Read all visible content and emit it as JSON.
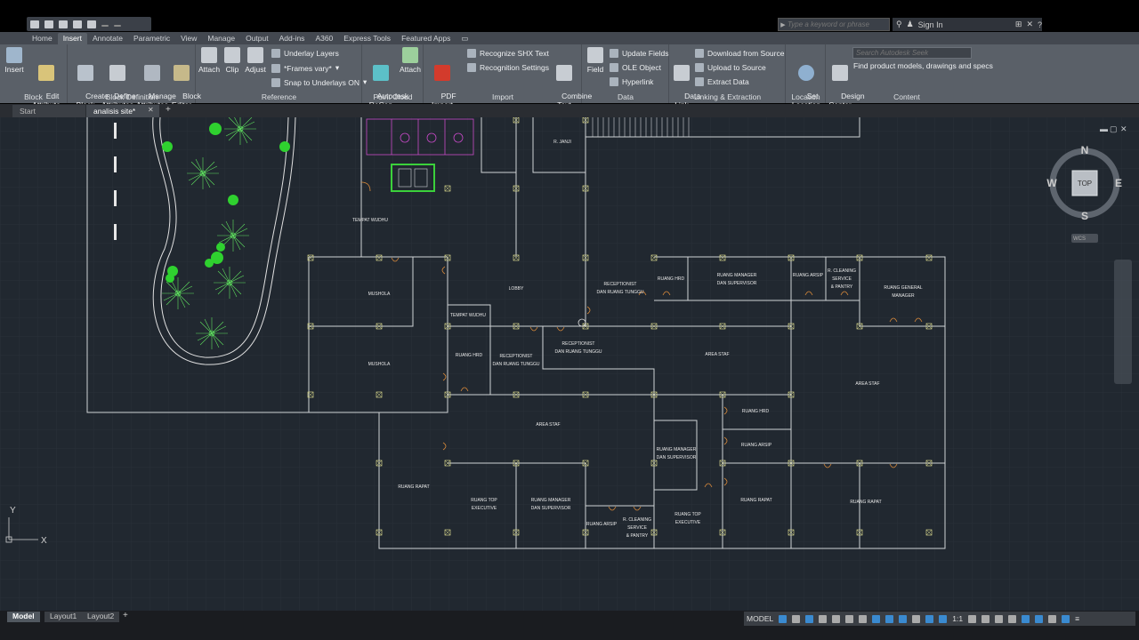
{
  "app": {
    "search_placeholder": "Type a keyword or phrase",
    "sign_in": "Sign In"
  },
  "ribbon_tabs": [
    "Home",
    "Insert",
    "Annotate",
    "Parametric",
    "View",
    "Manage",
    "Output",
    "Add-ins",
    "A360",
    "Express Tools",
    "Featured Apps"
  ],
  "ribbon": {
    "block_panel": {
      "title": "Block",
      "insert": "Insert",
      "edit_attribute": "Edit\nAttribute"
    },
    "block_def_panel": {
      "title": "Block Definition",
      "create_block": "Create\nBlock",
      "define_attributes": "Define\nAttributes",
      "manage_attributes": "Manage\nAttributes",
      "block_editor": "Block\nEditor"
    },
    "reference_panel": {
      "title": "Reference",
      "attach": "Attach",
      "clip": "Clip",
      "adjust": "Adjust",
      "underlay_layers": "Underlay Layers",
      "frames_vary": "*Frames vary*",
      "snap_underlays": "Snap to Underlays ON"
    },
    "point_cloud_panel": {
      "title": "Point Cloud",
      "recap": "Autodesk\nReCap",
      "attach": "Attach"
    },
    "import_panel": {
      "title": "Import",
      "pdf_import": "PDF\nImport",
      "recognize_shx": "Recognize SHX Text",
      "recognition_settings": "Recognition Settings",
      "combine_text": "Combine\nText"
    },
    "data_panel": {
      "title": "Data",
      "field": "Field",
      "update_fields": "Update Fields",
      "ole_object": "OLE Object",
      "hyperlink": "Hyperlink"
    },
    "linking_panel": {
      "title": "Linking & Extraction",
      "data_link": "Data\nLink",
      "download_source": "Download from Source",
      "upload_source": "Upload to Source",
      "extract_data": "Extract  Data"
    },
    "location_panel": {
      "title": "Location",
      "set_location": "Set\nLocation"
    },
    "content_panel": {
      "title": "Content",
      "design_center": "Design\nCenter",
      "seek_placeholder": "Search Autodesk Seek",
      "seek_desc": "Find product models, drawings and specs"
    }
  },
  "file_tabs": [
    "Start",
    "analisis site*"
  ],
  "viewcube": {
    "n": "N",
    "s": "S",
    "e": "E",
    "w": "W",
    "top": "TOP",
    "wcs": "WCS"
  },
  "ucs": {
    "x": "X",
    "y": "Y"
  },
  "rooms": {
    "tempat_wudhu_1": "TEMPAT WUDHU",
    "tempat_wudhu_2": "TEMPAT WUDHU",
    "mushola_1": "MUSHOLA",
    "mushola_2": "MUSHOLA",
    "lobby": "LOBBY",
    "r_janji": "R. JANJI",
    "receptionist_1a": "RECEPTIONIST",
    "receptionist_1b": "DAN RUANG TUNGGU",
    "receptionist_2a": "RECEPTIONIST",
    "receptionist_2b": "DAN RUANG TUNGGU",
    "receptionist_3a": "RECEPTIONIST",
    "receptionist_3b": "DAN RUANG TUNGGU",
    "ruang_hrd_1": "RUANG HRD",
    "ruang_hrd_2": "RUANG HRD",
    "ruang_hrd_3": "RUANG HRD",
    "ruang_manager_1a": "RUANG MANAGER",
    "ruang_manager_1b": "DAN SUPERVISOR",
    "ruang_manager_2a": "RUANG MANAGER",
    "ruang_manager_2b": "DAN SUPERVISOR",
    "ruang_manager_3a": "RUANG MANAGER",
    "ruang_manager_3b": "DAN SUPERVISOR",
    "ruang_arsip_1": "RUANG ARSIP",
    "ruang_arsip_2": "RUANG ARSIP",
    "ruang_arsip_3": "RUANG ARSIP",
    "cleaning_1a": "R. CLEANING",
    "cleaning_1b": "SERVICE",
    "cleaning_1c": "& PANTRY",
    "cleaning_2a": "R. CLEANING",
    "cleaning_2b": "SERVICE",
    "cleaning_2c": "& PANTRY",
    "general_manager_a": "RUANG GENERAL",
    "general_manager_b": "MANAGER",
    "area_staf_1": "AREA STAF",
    "area_staf_2": "AREA STAF",
    "area_staf_3": "AREA STAF",
    "ruang_rapat_1": "RUANG RAPAT",
    "ruang_rapat_2": "RUANG RAPAT",
    "ruang_rapat_3": "RUANG RAPAT",
    "ruang_top_1a": "RUANG TOP",
    "ruang_top_1b": "EXECUTIVE",
    "ruang_top_2a": "RUANG TOP",
    "ruang_top_2b": "EXECUTIVE"
  },
  "layout_tabs": [
    "Model",
    "Layout1",
    "Layout2"
  ],
  "status": {
    "model": "MODEL",
    "scale": "1:1"
  },
  "colors": {
    "accent": "#3a8ad0",
    "wall": "#cfd3d6",
    "tree": "#2fd12f",
    "door": "#d98a3a",
    "toilet": "#c84ac8"
  }
}
